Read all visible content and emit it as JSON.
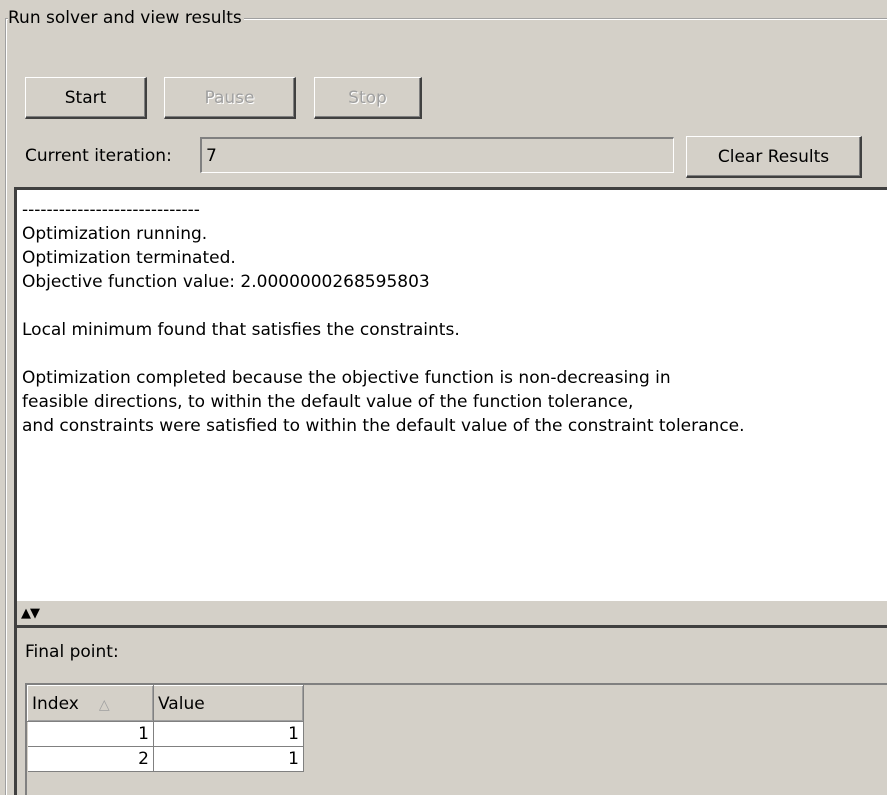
{
  "group": {
    "title": "Run solver and view results"
  },
  "buttons": {
    "start": "Start",
    "pause": "Pause",
    "stop": "Stop",
    "clear": "Clear Results"
  },
  "iteration": {
    "label": "Current iteration:",
    "value": "7"
  },
  "output": {
    "text": "-----------------------------\nOptimization running.\nOptimization terminated.\nObjective function value: 2.0000000268595803\n\nLocal minimum found that satisfies the constraints.\n\nOptimization completed because the objective function is non-decreasing in\nfeasible directions, to within the default value of the function tolerance,\nand constraints were satisfied to within the default value of the constraint tolerance."
  },
  "splitter": {
    "arrows": "▲▼"
  },
  "final_point": {
    "label": "Final point:",
    "columns": [
      "Index",
      "Value"
    ],
    "sort_icon": "△",
    "rows": [
      {
        "index": "1",
        "value": "1"
      },
      {
        "index": "2",
        "value": "1"
      }
    ]
  }
}
